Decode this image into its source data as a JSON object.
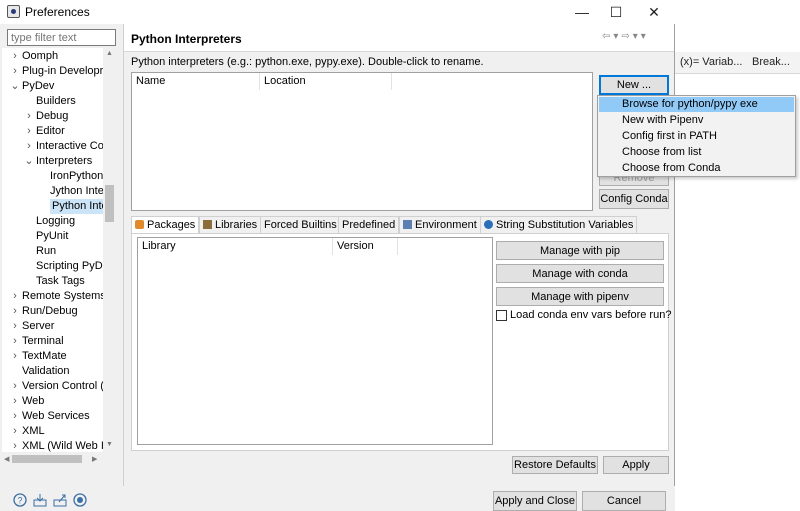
{
  "background": {
    "tabs": [
      {
        "label": "(x)= Variab..."
      },
      {
        "label": "Break..."
      }
    ]
  },
  "window": {
    "title": "Preferences",
    "controls": {
      "minimize": "—",
      "maximize": "☐",
      "close": "✕"
    }
  },
  "sidebar": {
    "filter_placeholder": "type filter text",
    "items": [
      {
        "label": "Oomph",
        "level": 0,
        "expander": "collapsed"
      },
      {
        "label": "Plug-in Developr",
        "level": 0,
        "expander": "collapsed"
      },
      {
        "label": "PyDev",
        "level": 0,
        "expander": "expanded"
      },
      {
        "label": "Builders",
        "level": 1,
        "expander": "none"
      },
      {
        "label": "Debug",
        "level": 1,
        "expander": "collapsed"
      },
      {
        "label": "Editor",
        "level": 1,
        "expander": "collapsed"
      },
      {
        "label": "Interactive Co",
        "level": 1,
        "expander": "collapsed"
      },
      {
        "label": "Interpreters",
        "level": 1,
        "expander": "expanded"
      },
      {
        "label": "IronPython",
        "level": 2,
        "expander": "none"
      },
      {
        "label": "Jython Inte",
        "level": 2,
        "expander": "none"
      },
      {
        "label": "Python Inte",
        "level": 2,
        "expander": "none",
        "selected": true
      },
      {
        "label": "Logging",
        "level": 1,
        "expander": "none"
      },
      {
        "label": "PyUnit",
        "level": 1,
        "expander": "none"
      },
      {
        "label": "Run",
        "level": 1,
        "expander": "none"
      },
      {
        "label": "Scripting PyDe",
        "level": 1,
        "expander": "none"
      },
      {
        "label": "Task Tags",
        "level": 1,
        "expander": "none"
      },
      {
        "label": "Remote Systems",
        "level": 0,
        "expander": "collapsed"
      },
      {
        "label": "Run/Debug",
        "level": 0,
        "expander": "collapsed"
      },
      {
        "label": "Server",
        "level": 0,
        "expander": "collapsed"
      },
      {
        "label": "Terminal",
        "level": 0,
        "expander": "collapsed"
      },
      {
        "label": "TextMate",
        "level": 0,
        "expander": "collapsed"
      },
      {
        "label": "Validation",
        "level": 0,
        "expander": "none"
      },
      {
        "label": "Version Control (",
        "level": 0,
        "expander": "collapsed"
      },
      {
        "label": "Web",
        "level": 0,
        "expander": "collapsed"
      },
      {
        "label": "Web Services",
        "level": 0,
        "expander": "collapsed"
      },
      {
        "label": "XML",
        "level": 0,
        "expander": "collapsed"
      },
      {
        "label": "XML (Wild Web I",
        "level": 0,
        "expander": "collapsed"
      }
    ]
  },
  "page": {
    "title": "Python Interpreters",
    "description": "Python interpreters (e.g.: python.exe, pypy.exe).   Double-click to rename.",
    "interpreters_table": {
      "columns": [
        "Name",
        "Location"
      ]
    },
    "buttons": {
      "new": "New ...",
      "remove": "Remove",
      "config_conda": "Config Conda"
    },
    "new_menu": [
      "Browse for python/pypy exe",
      "New with Pipenv",
      "Config first in PATH",
      "Choose from list",
      "Choose from Conda"
    ],
    "tabs": [
      {
        "label": "Packages",
        "active": true
      },
      {
        "label": "Libraries"
      },
      {
        "label": "Forced Builtins"
      },
      {
        "label": "Predefined"
      },
      {
        "label": "Environment"
      },
      {
        "label": "String Substitution Variables"
      }
    ],
    "packages_table": {
      "columns": [
        "Library",
        "Version"
      ]
    },
    "package_buttons": {
      "pip": "Manage with pip",
      "conda": "Manage with conda",
      "pipenv": "Manage with pipenv"
    },
    "conda_checkbox": {
      "label": "Load conda env vars before run?",
      "checked": false
    },
    "restore_defaults": "Restore Defaults",
    "apply": "Apply"
  },
  "footer": {
    "apply_and_close": "Apply and Close",
    "cancel": "Cancel",
    "icons": [
      "help-icon",
      "import-icon",
      "export-icon",
      "record-icon"
    ]
  },
  "colors": {
    "selection": "#cce4f7",
    "menu_highlight": "#91c9f7",
    "focus_border": "#0078d7"
  }
}
